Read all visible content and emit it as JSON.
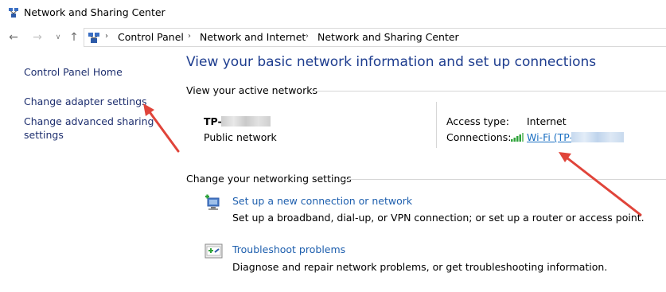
{
  "window": {
    "title": "Network and Sharing Center",
    "icon": "network-sharing-icon"
  },
  "nav": {
    "back_icon": "arrow-left-icon",
    "forward_icon": "arrow-right-icon",
    "recent_icon": "chevron-down-icon",
    "up_icon": "arrow-up-icon",
    "breadcrumb": [
      "Control Panel",
      "Network and Internet",
      "Network and Sharing Center"
    ]
  },
  "sidebar": {
    "items": [
      {
        "label": "Control Panel Home"
      },
      {
        "label": "Change adapter settings"
      },
      {
        "label": "Change advanced sharing"
      },
      {
        "label": "settings"
      }
    ]
  },
  "main": {
    "heading": "View your basic network information and set up connections",
    "active_networks": {
      "section_title": "View your active networks",
      "network_name": "TP-",
      "network_category": "Public network",
      "access_type_label": "Access type:",
      "access_type_value": "Internet",
      "connections_label": "Connections:",
      "connection_link": "Wi-Fi (TP-"
    },
    "change_settings": {
      "section_title": "Change your networking settings",
      "tasks": [
        {
          "icon": "new-connection-icon",
          "link": "Set up a new connection or network",
          "description": "Set up a broadband, dial-up, or VPN connection; or set up a router or access point."
        },
        {
          "icon": "troubleshoot-icon",
          "link": "Troubleshoot problems",
          "description": "Diagnose and repair network problems, or get troubleshooting information."
        }
      ]
    }
  },
  "colors": {
    "link_blue": "#1a6fc2",
    "heading_blue": "#1e3d8f",
    "annotation_red": "#e0443a"
  }
}
